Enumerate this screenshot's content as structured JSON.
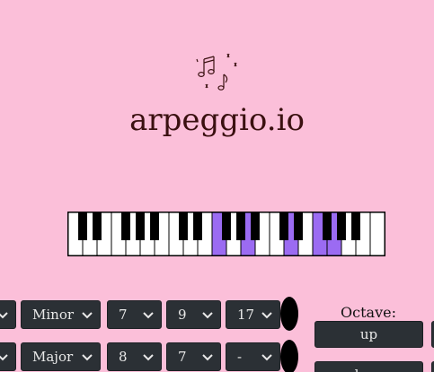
{
  "app": {
    "title": "arpeggio.io",
    "logo_icon": "music-notes-icon"
  },
  "colors": {
    "background": "#fbbfd9",
    "highlight": "#9b6bf2",
    "control_bg": "#2b3035",
    "title_color": "#3a1010"
  },
  "piano": {
    "white_key_count": 22,
    "highlighted_white_keys": [
      10,
      12,
      15,
      17,
      18
    ]
  },
  "row1": {
    "select0": "",
    "quality": "Minor",
    "num1": "7",
    "num2": "9",
    "num3": "17"
  },
  "row2": {
    "select0": "",
    "quality": "Major",
    "num1": "8",
    "num2": "7",
    "num3": "-"
  },
  "octave": {
    "label": "Octave:",
    "up_label": "up",
    "down_label": "down"
  }
}
